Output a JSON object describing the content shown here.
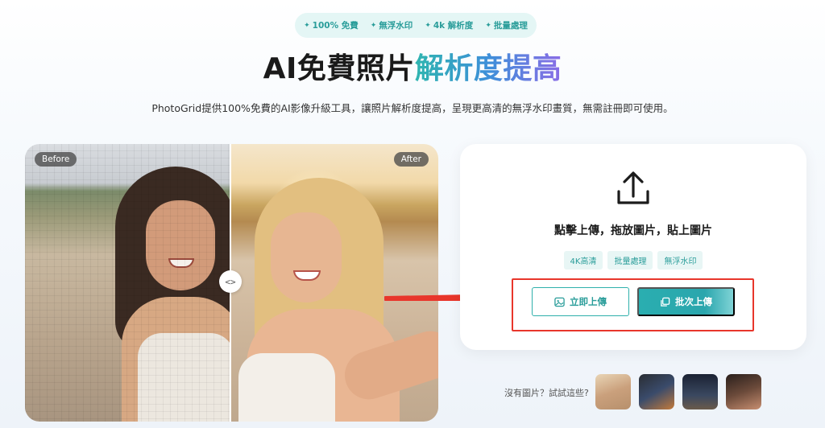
{
  "features": [
    {
      "icon": "✦",
      "label": "100% 免費"
    },
    {
      "icon": "✦",
      "label": "無浮水印"
    },
    {
      "icon": "✦",
      "label": "4k 解析度"
    },
    {
      "icon": "✦",
      "label": "批量處理"
    }
  ],
  "hero": {
    "title_plain": "AI免費照片",
    "title_highlight": "解析度提高",
    "subtitle": "PhotoGrid提供100%免費的AI影像升級工具，讓照片解析度提高，呈現更高清的無浮水印畫質，無需註冊即可使用。"
  },
  "compare": {
    "before_label": "Before",
    "after_label": "After",
    "handle_glyph": "<>"
  },
  "upload": {
    "hint": "點擊上傳，拖放圖片，貼上圖片",
    "chips": [
      "4K高清",
      "批量處理",
      "無浮水印"
    ],
    "upload_button": "立即上傳",
    "batch_button": "批次上傳"
  },
  "samples": {
    "label": "沒有圖片？試試這些?"
  },
  "colors": {
    "accent": "#2fb0ab",
    "annotation": "#e8362b"
  }
}
